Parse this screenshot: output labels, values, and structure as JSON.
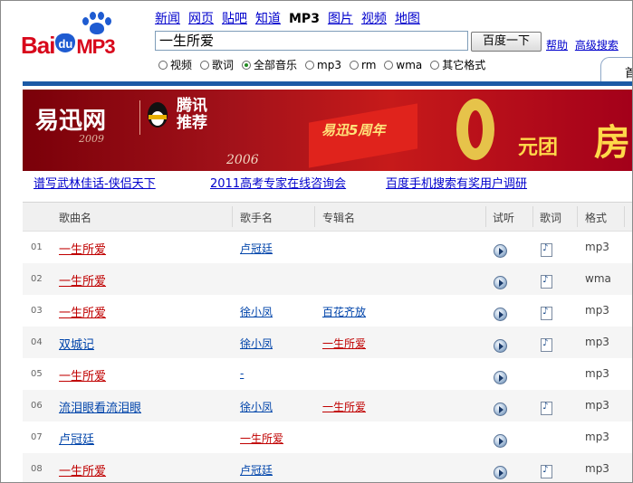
{
  "logo": {
    "part1": "Bai",
    "part2": "du",
    "part3": "MP3"
  },
  "nav": [
    {
      "label": "新闻",
      "current": false
    },
    {
      "label": "网页",
      "current": false
    },
    {
      "label": "贴吧",
      "current": false
    },
    {
      "label": "知道",
      "current": false
    },
    {
      "label": "MP3",
      "current": true
    },
    {
      "label": "图片",
      "current": false
    },
    {
      "label": "视频",
      "current": false
    },
    {
      "label": "地图",
      "current": false
    }
  ],
  "search": {
    "value": "一生所爱",
    "button": "百度一下"
  },
  "toplinks": {
    "help": "帮助",
    "advanced": "高级搜索"
  },
  "filters": [
    {
      "label": "视频",
      "checked": false
    },
    {
      "label": "歌词",
      "checked": false
    },
    {
      "label": "全部音乐",
      "checked": true
    },
    {
      "label": "mp3",
      "checked": false
    },
    {
      "label": "rm",
      "checked": false
    },
    {
      "label": "wma",
      "checked": false
    },
    {
      "label": "其它格式",
      "checked": false
    }
  ],
  "tab_corner": "首",
  "banner": {
    "brand": "易迅网",
    "year_a": "2009",
    "partner": "腾讯",
    "partner_sub": "推荐",
    "year_b": "2006",
    "flag_text": "易迅5周年",
    "zero": "0",
    "yuan_tuan": "元团",
    "tail": "房"
  },
  "ad_links": [
    "谱写武林佳话-侠侣天下",
    "2011高考专家在线咨询会",
    "百度手机搜索有奖用户调研"
  ],
  "table": {
    "headers": {
      "song": "歌曲名",
      "artist": "歌手名",
      "album": "专辑名",
      "listen": "试听",
      "lyrics": "歌词",
      "format": "格式"
    },
    "rows": [
      {
        "num": "01",
        "song": "一生所爱",
        "song_red": true,
        "artist": "卢冠廷",
        "artist_red": false,
        "album": "",
        "album_red": false,
        "lyrics": true,
        "format": "mp3"
      },
      {
        "num": "02",
        "song": "一生所爱",
        "song_red": true,
        "artist": "",
        "artist_red": false,
        "album": "",
        "album_red": false,
        "lyrics": true,
        "format": "wma"
      },
      {
        "num": "03",
        "song": "一生所爱",
        "song_red": true,
        "artist": "徐小凤",
        "artist_red": false,
        "album": "百花齐放",
        "album_red": false,
        "lyrics": true,
        "format": "mp3"
      },
      {
        "num": "04",
        "song": "双城记",
        "song_red": false,
        "artist": "徐小凤",
        "artist_red": false,
        "album": "一生所爱",
        "album_red": true,
        "lyrics": true,
        "format": "mp3"
      },
      {
        "num": "05",
        "song": "一生所爱",
        "song_red": true,
        "artist": "-",
        "artist_red": false,
        "album": "",
        "album_red": false,
        "lyrics": false,
        "format": "mp3"
      },
      {
        "num": "06",
        "song": "流泪眼看流泪眼",
        "song_red": false,
        "artist": "徐小凤",
        "artist_red": false,
        "album": "一生所爱",
        "album_red": true,
        "lyrics": true,
        "format": "mp3"
      },
      {
        "num": "07",
        "song": "卢冠廷",
        "song_red": false,
        "artist": "一生所爱",
        "artist_red": true,
        "album": "",
        "album_red": false,
        "lyrics": false,
        "format": "mp3"
      },
      {
        "num": "08",
        "song": "一生所爱",
        "song_red": true,
        "artist": "卢冠廷",
        "artist_red": false,
        "album": "",
        "album_red": false,
        "lyrics": true,
        "format": "mp3"
      }
    ]
  },
  "colors": {
    "link": "#0000cc",
    "hit_red": "#c00000",
    "brand_blue": "#1c5aa6"
  }
}
